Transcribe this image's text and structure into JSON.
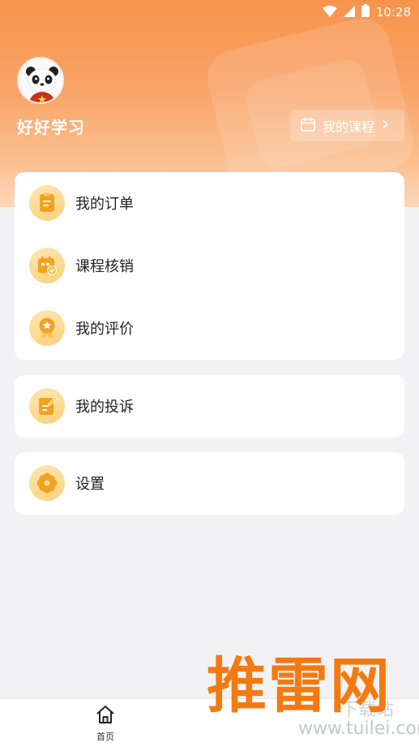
{
  "status_bar": {
    "time": "10:28"
  },
  "profile": {
    "username": "好好学习"
  },
  "header": {
    "course_button_label": "我的课程"
  },
  "menu": {
    "group1": [
      {
        "label": "我的订单",
        "icon": "order-icon"
      },
      {
        "label": "课程核销",
        "icon": "course-verify-icon"
      },
      {
        "label": "我的评价",
        "icon": "rating-icon"
      }
    ],
    "group2": [
      {
        "label": "我的投诉",
        "icon": "complaint-icon"
      }
    ],
    "group3": [
      {
        "label": "设置",
        "icon": "settings-icon"
      }
    ]
  },
  "tabbar": {
    "home_label": "首页"
  },
  "watermark": {
    "brand": "推雷网",
    "domain": "www.tuilei.com",
    "extra": "下载站"
  },
  "colors": {
    "accent": "#f7944c",
    "icon_bg": "#fbd17a",
    "icon_fg": "#f0a21f"
  }
}
